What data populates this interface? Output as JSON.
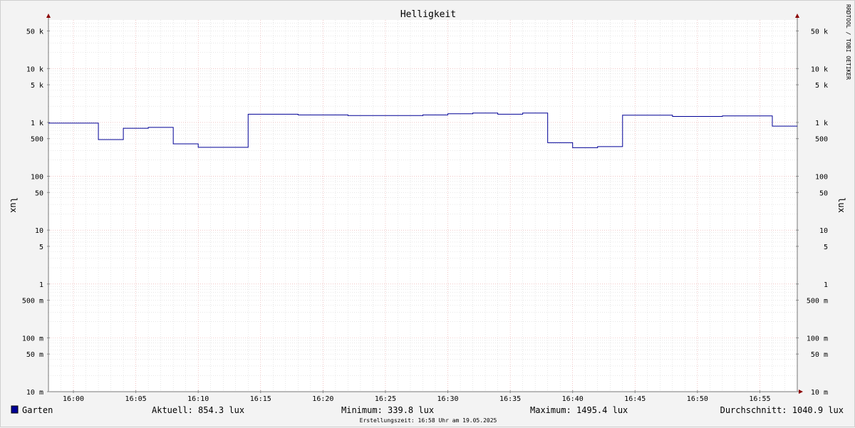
{
  "colors": {
    "background": "#f3f3f3",
    "plot_background": "#ffffff",
    "series": "#000096",
    "grid_major": "#e8a0a0",
    "grid_minor": "#cfcfcf",
    "arrow": "#8b0000",
    "watermark": "#b0b0b0"
  },
  "watermark": "RRDTOOL / TOBI OETIKER",
  "footer": "Erstellungszeit: 16:58 Uhr am 19.05.2025",
  "stats": {
    "current": "Aktuell: 854.3 lux",
    "minimum": "Minimum: 339.8 lux",
    "maximum": "Maximum: 1495.4 lux",
    "average": "Durchschnitt: 1040.9 lux"
  },
  "chart_data": {
    "type": "line",
    "title": "Helligkeit",
    "xlabel": "",
    "ylabel": "lux",
    "ylabel_right": "lux",
    "yscale": "log",
    "ylim": [
      0.01,
      80000
    ],
    "xlim": [
      "15:58",
      "17:58"
    ],
    "xlim_minutes": [
      -2,
      58
    ],
    "x_ticks": [
      "16:00",
      "16:05",
      "16:10",
      "16:15",
      "16:20",
      "16:25",
      "16:30",
      "16:35",
      "16:40",
      "16:45",
      "16:50",
      "16:55"
    ],
    "x_tick_minutes": [
      0,
      5,
      10,
      15,
      20,
      25,
      30,
      35,
      40,
      45,
      50,
      55
    ],
    "y_ticks": [
      {
        "value": 50000,
        "label": "50 k"
      },
      {
        "value": 10000,
        "label": "10 k"
      },
      {
        "value": 5000,
        "label": "5 k"
      },
      {
        "value": 1000,
        "label": "1 k"
      },
      {
        "value": 500,
        "label": "500"
      },
      {
        "value": 100,
        "label": "100"
      },
      {
        "value": 50,
        "label": "50"
      },
      {
        "value": 10,
        "label": "10"
      },
      {
        "value": 5,
        "label": "5"
      },
      {
        "value": 1,
        "label": "1"
      },
      {
        "value": 0.5,
        "label": "500 m"
      },
      {
        "value": 0.1,
        "label": "100 m"
      },
      {
        "value": 0.05,
        "label": "50 m"
      },
      {
        "value": 0.01,
        "label": "10 m"
      }
    ],
    "grid": true,
    "legend": "bottom-left",
    "series": [
      {
        "name": "Garten",
        "step": true,
        "x_minutes": [
          -2,
          2,
          4,
          6,
          8,
          10,
          14,
          18,
          22,
          28,
          30,
          32,
          34,
          36,
          38,
          40,
          42,
          44,
          48,
          52,
          56
        ],
        "end_minute": 58,
        "values": [
          970,
          480,
          780,
          810,
          400,
          345,
          1420,
          1380,
          1340,
          1380,
          1450,
          1495,
          1420,
          1490,
          420,
          340,
          355,
          1360,
          1290,
          1320,
          854
        ]
      }
    ]
  }
}
